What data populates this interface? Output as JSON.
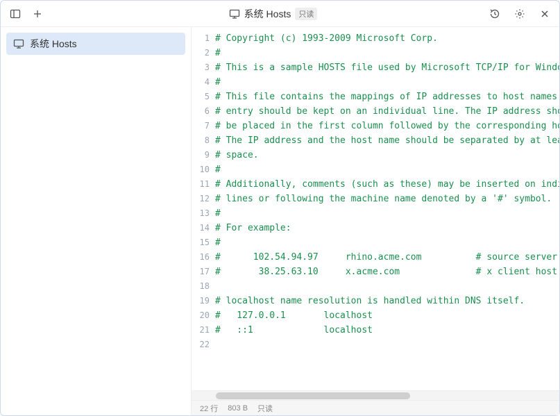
{
  "header": {
    "title": "系统 Hosts",
    "readonly_badge": "只读"
  },
  "sidebar": {
    "items": [
      {
        "label": "系统 Hosts"
      }
    ]
  },
  "editor": {
    "lines": [
      "# Copyright (c) 1993-2009 Microsoft Corp.",
      "#",
      "# This is a sample HOSTS file used by Microsoft TCP/IP for Windows.",
      "#",
      "# This file contains the mappings of IP addresses to host names. Each",
      "# entry should be kept on an individual line. The IP address should",
      "# be placed in the first column followed by the corresponding host name.",
      "# The IP address and the host name should be separated by at least one",
      "# space.",
      "#",
      "# Additionally, comments (such as these) may be inserted on individual",
      "# lines or following the machine name denoted by a '#' symbol.",
      "#",
      "# For example:",
      "#",
      "#      102.54.94.97     rhino.acme.com          # source server",
      "#       38.25.63.10     x.acme.com              # x client host",
      "",
      "# localhost name resolution is handled within DNS itself.",
      "#   127.0.0.1       localhost",
      "#   ::1             localhost",
      ""
    ]
  },
  "statusbar": {
    "lines_label": "22 行",
    "size_label": "803 B",
    "readonly_label": "只读"
  }
}
